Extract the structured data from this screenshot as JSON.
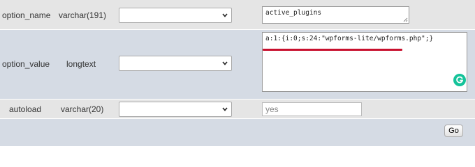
{
  "rows": [
    {
      "name": "option_name",
      "type": "varchar(191)",
      "function": "",
      "value": "active_plugins"
    },
    {
      "name": "option_value",
      "type": "longtext",
      "function": "",
      "value": "a:1:{i:0;s:24:\"wpforms-lite/wpforms.php\";}"
    },
    {
      "name": "autoload",
      "type": "varchar(20)",
      "function": "",
      "value": "yes"
    }
  ],
  "go_button": {
    "label": "Go"
  },
  "colors": {
    "row_light": "#e5e5e5",
    "row_blue": "#d5dbe4",
    "highlight_underline": "#c8102e",
    "grammarly": "#15c39a"
  },
  "icons": {
    "select_arrow": "chevron-down-icon",
    "resize": "resize-grip-icon",
    "grammarly": "grammarly-icon"
  }
}
